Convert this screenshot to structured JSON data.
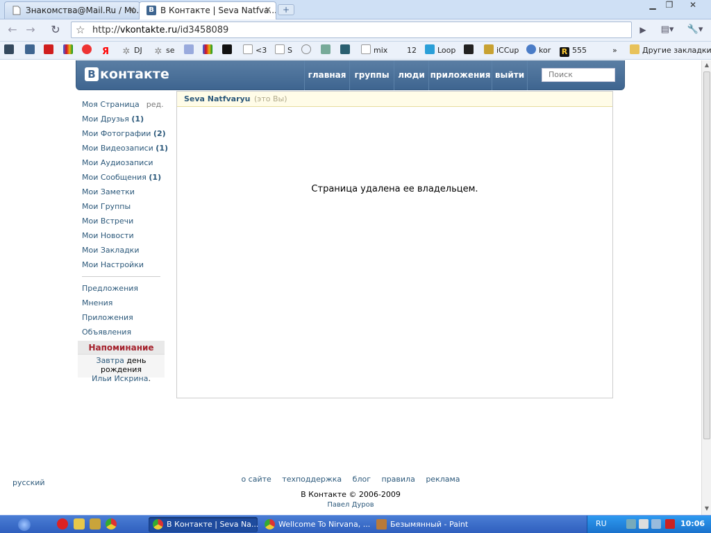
{
  "browser": {
    "tabs": [
      {
        "title": "Знакомства@Mail.Ru / Мо...",
        "active": false
      },
      {
        "title": "В Контакте | Seva Natfva...",
        "active": true
      }
    ],
    "new_tab_icon": "plus-icon",
    "url_prefix": "http://",
    "url_host": "vkontakte.ru",
    "url_path": "/id3458089",
    "bookmarks": [
      {
        "label": "",
        "icon": "rambler-icon"
      },
      {
        "label": "",
        "icon": "vk-icon"
      },
      {
        "label": "",
        "icon": "youtube-icon"
      },
      {
        "label": "",
        "icon": "igoogle-icon"
      },
      {
        "label": "",
        "icon": "red-arrow-icon"
      },
      {
        "label": "",
        "icon": "yandex-icon"
      },
      {
        "label": "DJ",
        "icon": "gear-icon"
      },
      {
        "label": "se",
        "icon": "gear-icon"
      },
      {
        "label": "",
        "icon": "boat-icon"
      },
      {
        "label": "",
        "icon": "igoogle-icon"
      },
      {
        "label": "",
        "icon": "tv-icon"
      },
      {
        "label": "<3",
        "icon": "page-icon"
      },
      {
        "label": "S",
        "icon": "page-icon"
      },
      {
        "label": "",
        "icon": "circle-icon"
      },
      {
        "label": "",
        "icon": "picture-icon"
      },
      {
        "label": "",
        "icon": "n-icon"
      },
      {
        "label": "mix",
        "icon": "page-icon"
      },
      {
        "label": "12",
        "icon": ""
      },
      {
        "label": "Loop",
        "icon": "v-icon"
      },
      {
        "label": "",
        "icon": "dark-icon"
      },
      {
        "label": "iCCup",
        "icon": "torch-icon"
      },
      {
        "label": "kor",
        "icon": "globe-icon"
      },
      {
        "label": "555",
        "icon": "r-icon"
      }
    ],
    "overflow": "»",
    "other_bookmarks": "Другие закладки"
  },
  "vk": {
    "logo": "контакте",
    "logo_letter": "В",
    "nav": [
      "главная",
      "группы",
      "люди",
      "приложения",
      "выйти"
    ],
    "search_placeholder": "Поиск",
    "menu": [
      {
        "label": "Моя Страница",
        "count": "",
        "extra": "ред."
      },
      {
        "label": "Мои Друзья",
        "count": "(1)"
      },
      {
        "label": "Мои Фотографии",
        "count": "(2)"
      },
      {
        "label": "Мои Видеозаписи",
        "count": "(1)"
      },
      {
        "label": "Мои Аудиозаписи",
        "count": ""
      },
      {
        "label": "Мои Сообщения",
        "count": "(1)"
      },
      {
        "label": "Мои Заметки",
        "count": ""
      },
      {
        "label": "Мои Группы",
        "count": ""
      },
      {
        "label": "Мои Встречи",
        "count": ""
      },
      {
        "label": "Мои Новости",
        "count": ""
      },
      {
        "label": "Мои Закладки",
        "count": ""
      },
      {
        "label": "Мои Настройки",
        "count": ""
      }
    ],
    "menu2": [
      "Предложения",
      "Мнения",
      "Приложения",
      "Объявления"
    ],
    "reminder": {
      "title": "Напоминание",
      "link1": "Завтра",
      "text1": " день рождения",
      "link2": "Ильи Искрина",
      "text2": "."
    },
    "profile_name": "Seva Natfvaryu",
    "profile_you": "(это Вы)",
    "deleted_message": "Страница удалена ее владельцем.",
    "footer_links": [
      "о сайте",
      "техподдержка",
      "блог",
      "правила",
      "реклама"
    ],
    "copyright": "В Контакте © 2006-2009",
    "language": "русский",
    "author": "Павел Дуров"
  },
  "taskbar": {
    "tasks": [
      {
        "title": "В Контакте | Seva Na...",
        "active": true
      },
      {
        "title": "Wellcome To Nirvana, ...",
        "active": false
      },
      {
        "title": "Безымянный - Paint",
        "active": false
      }
    ],
    "lang": "RU",
    "clock": "10:06"
  }
}
